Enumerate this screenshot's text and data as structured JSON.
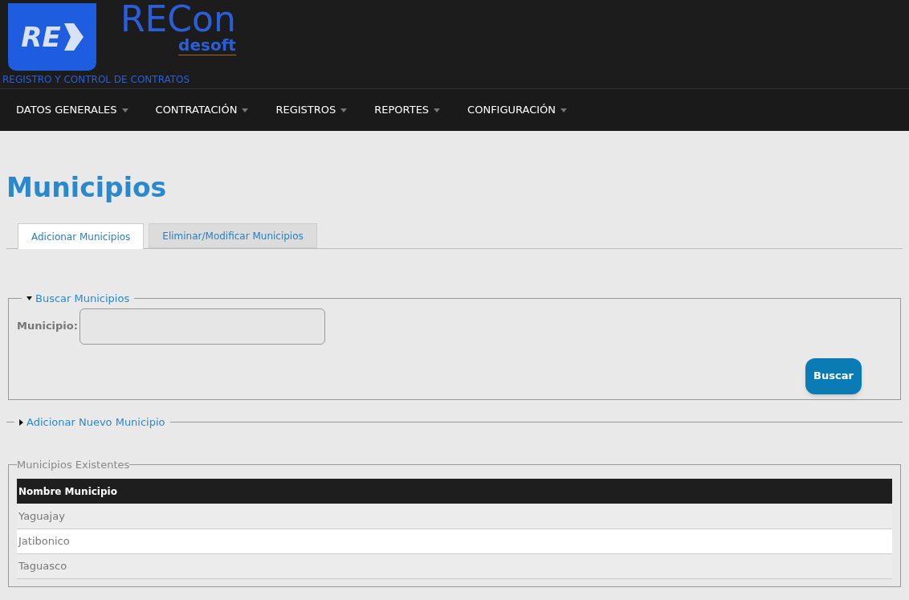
{
  "header": {
    "logo_mark": "RE",
    "app_name": "RECon",
    "company": "desoft",
    "subtitle": "REGISTRO Y CONTROL DE CONTRATOS"
  },
  "menu": [
    {
      "label": "DATOS GENERALES"
    },
    {
      "label": "CONTRATACIÓN"
    },
    {
      "label": "REGISTROS"
    },
    {
      "label": "REPORTES"
    },
    {
      "label": "CONFIGURACIÓN"
    }
  ],
  "page_title": "Municipios",
  "tabs": [
    {
      "label": "Adicionar Municipios",
      "selected": true
    },
    {
      "label": "Eliminar/Modificar Municipios",
      "selected": false
    }
  ],
  "search_section": {
    "legend": "Buscar Municipios",
    "expanded": true,
    "field_label": "Municipio",
    "field_suffix": ":",
    "button": "Buscar"
  },
  "add_section": {
    "legend": "Adicionar Nuevo Municipio",
    "expanded": false
  },
  "existing": {
    "legend": "Municipios Existentes",
    "columns": [
      "Nombre Municipio"
    ],
    "rows": [
      [
        "Yaguajay"
      ],
      [
        "Jatibonico"
      ],
      [
        "Taguasco"
      ]
    ]
  }
}
